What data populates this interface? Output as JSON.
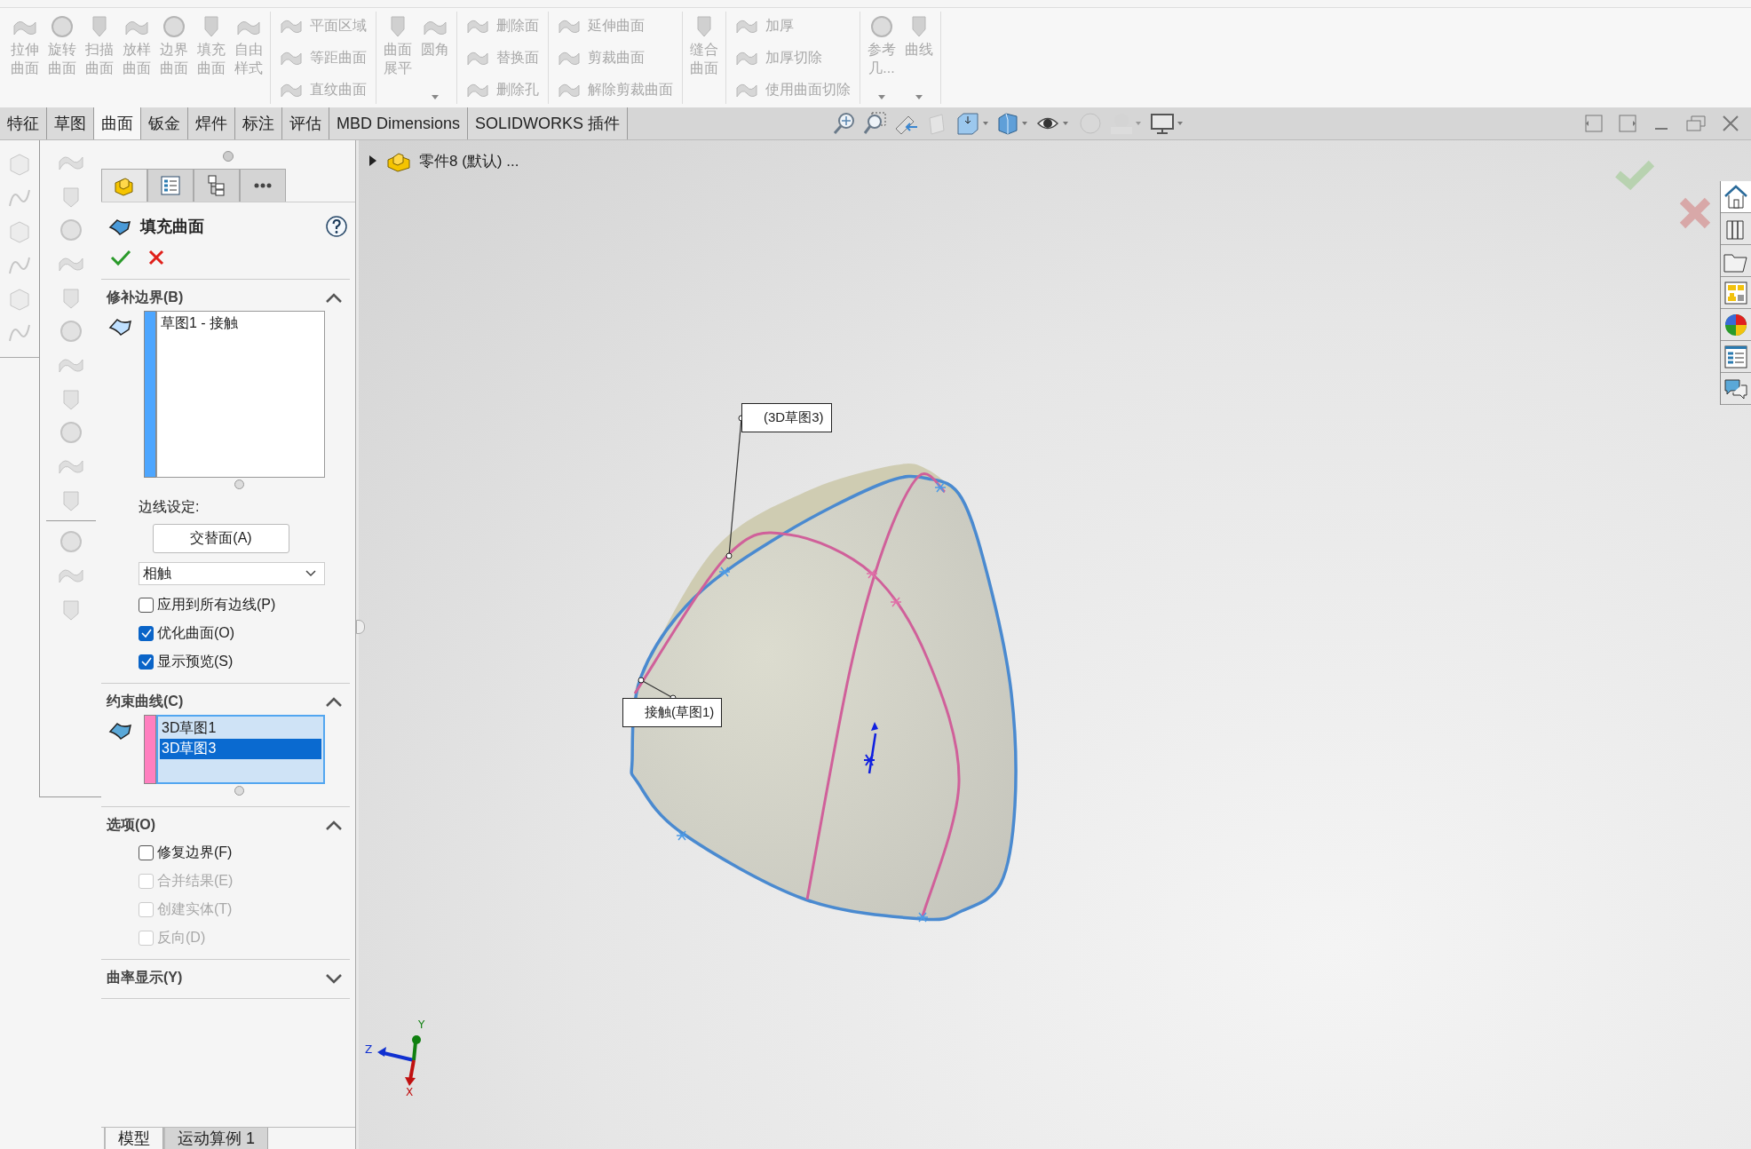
{
  "ribbon": {
    "disabled": true,
    "groups": [
      {
        "kind": "large",
        "items": [
          {
            "label": "拉伸曲面",
            "caret": false
          },
          {
            "label": "旋转曲面",
            "caret": false
          },
          {
            "label": "扫描曲面",
            "caret": false
          },
          {
            "label": "放样曲面",
            "caret": false
          },
          {
            "label": "边界曲面",
            "caret": false
          },
          {
            "label": "填充曲面",
            "caret": false
          },
          {
            "label": "自由样式",
            "caret": false
          }
        ]
      },
      {
        "kind": "stack",
        "items": [
          {
            "label": "平面区域"
          },
          {
            "label": "等距曲面"
          },
          {
            "label": "直纹曲面"
          }
        ]
      },
      {
        "kind": "large",
        "items": [
          {
            "label": "曲面展平",
            "caret": false
          },
          {
            "label": "圆角",
            "caret": true
          }
        ]
      },
      {
        "kind": "stack",
        "items": [
          {
            "label": "删除面"
          },
          {
            "label": "替换面"
          },
          {
            "label": "删除孔"
          }
        ]
      },
      {
        "kind": "stack",
        "items": [
          {
            "label": "延伸曲面"
          },
          {
            "label": "剪裁曲面"
          },
          {
            "label": "解除剪裁曲面"
          }
        ]
      },
      {
        "kind": "large",
        "items": [
          {
            "label": "缝合曲面",
            "caret": false
          }
        ]
      },
      {
        "kind": "stack",
        "items": [
          {
            "label": "加厚"
          },
          {
            "label": "加厚切除"
          },
          {
            "label": "使用曲面切除"
          }
        ]
      },
      {
        "kind": "large",
        "items": [
          {
            "label": "参考几...",
            "caret": true
          },
          {
            "label": "曲线",
            "caret": true
          }
        ]
      }
    ]
  },
  "tabs": [
    {
      "label": "特征",
      "selected": false
    },
    {
      "label": "草图",
      "selected": false
    },
    {
      "label": "曲面",
      "selected": true
    },
    {
      "label": "钣金",
      "selected": false
    },
    {
      "label": "焊件",
      "selected": false
    },
    {
      "label": "标注",
      "selected": false
    },
    {
      "label": "评估",
      "selected": false
    },
    {
      "label": "MBD Dimensions",
      "selected": false
    },
    {
      "label": "SOLIDWORKS 插件",
      "selected": false
    }
  ],
  "property_manager": {
    "tabs": [
      {
        "selected": true
      },
      {
        "selected": false
      },
      {
        "selected": false
      },
      {
        "selected": false
      }
    ],
    "title": "填充曲面",
    "sections": [
      {
        "title": "修补边界(B)",
        "expanded": true,
        "color": "#4da6ff",
        "active": false,
        "list": [
          {
            "label": "草图1 - 接触",
            "selected": false
          }
        ],
        "edge_label": "边线设定:",
        "button": "交替面(A)",
        "dropdown": "相触",
        "checkboxes": [
          {
            "label": "应用到所有边线(P)",
            "checked": false,
            "disabled": false
          },
          {
            "label": "优化曲面(O)",
            "checked": true,
            "disabled": false
          },
          {
            "label": "显示预览(S)",
            "checked": true,
            "disabled": false
          }
        ]
      },
      {
        "title": "约束曲线(C)",
        "expanded": true,
        "color": "#ff7fbf",
        "active": true,
        "list": [
          {
            "label": "3D草图1",
            "selected": false
          },
          {
            "label": "3D草图3",
            "selected": true
          }
        ]
      },
      {
        "title": "选项(O)",
        "expanded": true,
        "checkboxes": [
          {
            "label": "修复边界(F)",
            "checked": false,
            "disabled": false
          },
          {
            "label": "合并结果(E)",
            "checked": false,
            "disabled": true
          },
          {
            "label": "创建实体(T)",
            "checked": false,
            "disabled": true
          },
          {
            "label": "反向(D)",
            "checked": false,
            "disabled": true
          }
        ]
      },
      {
        "title": "曲率显示(Y)",
        "expanded": false
      }
    ]
  },
  "feature_tree": {
    "label": "零件8 (默认) ..."
  },
  "viewport": {
    "callouts": [
      {
        "text": "(3D草图3)"
      },
      {
        "text": "接触(草图1)"
      }
    ],
    "triad": {
      "x": "X",
      "y": "Y",
      "z": "Z"
    }
  },
  "bottom_tabs": [
    {
      "label": "模型",
      "selected": true
    },
    {
      "label": "运动算例 1",
      "selected": false
    }
  ]
}
